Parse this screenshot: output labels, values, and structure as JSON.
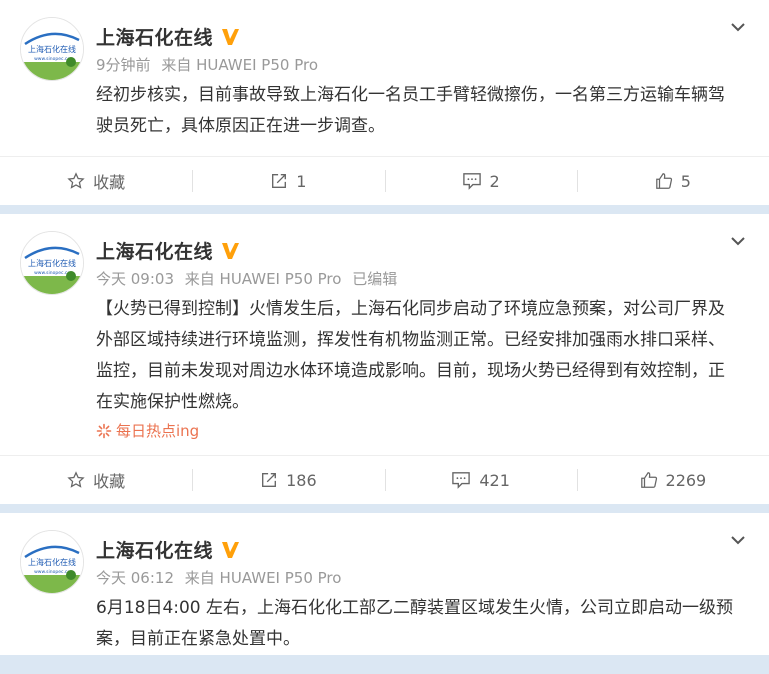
{
  "posts": [
    {
      "author": "上海石化在线",
      "meta": [
        "9分钟前",
        "来自 HUAWEI P50 Pro"
      ],
      "text": "经初步核实，目前事故导致上海石化一名员工手臂轻微擦伤，一名第三方运输车辆驾驶员死亡，具体原因正在进一步调查。",
      "actions": {
        "favorite": "收藏",
        "repost": "1",
        "comment": "2",
        "like": "5"
      }
    },
    {
      "author": "上海石化在线",
      "meta": [
        "今天 09:03",
        "来自 HUAWEI P50 Pro",
        "已编辑"
      ],
      "text": "【火势已得到控制】火情发生后，上海石化同步启动了环境应急预案，对公司厂界及外部区域持续进行环境监测，挥发性有机物监测正常。已经安排加强雨水排口采样、监控，目前未发现对周边水体环境造成影响。目前，现场火势已经得到有效控制，正在实施保护性燃烧。",
      "topic": "每日热点ing",
      "actions": {
        "favorite": "收藏",
        "repost": "186",
        "comment": "421",
        "like": "2269"
      }
    },
    {
      "author": "上海石化在线",
      "meta": [
        "今天 06:12",
        "来自 HUAWEI P50 Pro"
      ],
      "text": "6月18日4:00 左右，上海石化化工部乙二醇装置区域发生火情，公司立即启动一级预案，目前正在紧急处置中。"
    }
  ],
  "avatar_text": {
    "line1": "上海石化在线",
    "line2": "www.sinopec.cc"
  },
  "colors": {
    "verified": "#ffa00a",
    "topic": "#eb7350",
    "page_bg": "#dbe7f3"
  }
}
